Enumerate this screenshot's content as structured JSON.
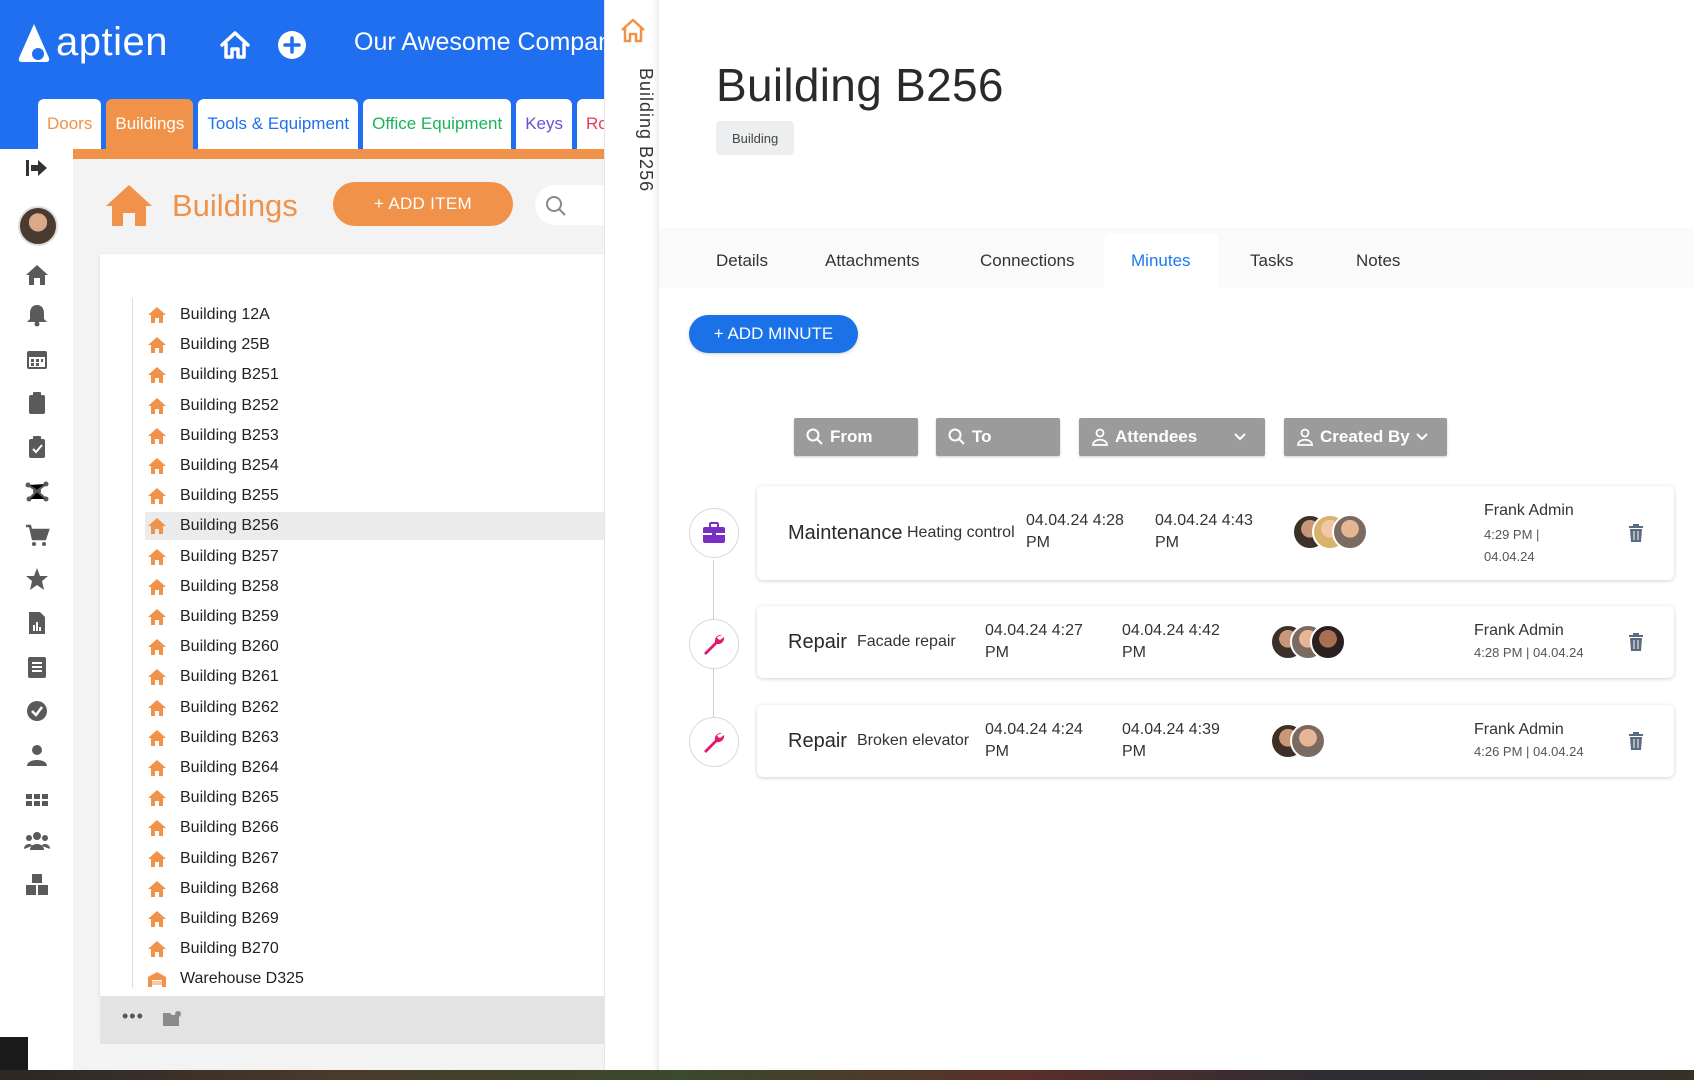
{
  "app": {
    "logo_text": "aptien",
    "company": "Our Awesome Company"
  },
  "tabs": [
    {
      "label": "Doors",
      "color": "#f0924a"
    },
    {
      "label": "Buildings",
      "color": "#ffffff"
    },
    {
      "label": "Tools & Equipment",
      "color": "#1f6ff0"
    },
    {
      "label": "Office Equipment",
      "color": "#19b35a"
    },
    {
      "label": "Keys",
      "color": "#6b4fd6"
    },
    {
      "label": "Ro",
      "color": "#e8375a"
    }
  ],
  "rail_icons": [
    "collapse-arrow-icon",
    "home-icon",
    "bell-icon",
    "calendar-icon",
    "clipboard-icon",
    "clipboard-check-icon",
    "network-icon",
    "cart-icon",
    "star-icon",
    "report-icon",
    "checklist-icon",
    "check-circle-icon",
    "person-icon",
    "apps-icon",
    "people-icon",
    "boxes-icon"
  ],
  "left": {
    "section_title": "Buildings",
    "add_item_label": "+ ADD ITEM",
    "tree_items": [
      "Building 12A",
      "Building 25B",
      "Building B251",
      "Building B252",
      "Building B253",
      "Building B254",
      "Building B255",
      "Building B256",
      "Building B257",
      "Building B258",
      "Building B259",
      "Building B260",
      "Building B261",
      "Building B262",
      "Building B263",
      "Building B264",
      "Building B265",
      "Building B266",
      "Building B267",
      "Building B268",
      "Building B269",
      "Building B270",
      "Warehouse D325"
    ],
    "selected_item": "Building B256",
    "footer_dots": "•••"
  },
  "panel": {
    "vertical_label": "Building B256",
    "title": "Building B256",
    "badge": "Building",
    "tabs": [
      "Details",
      "Attachments",
      "Connections",
      "Minutes",
      "Tasks",
      "Notes"
    ],
    "active_tab": "Minutes",
    "add_minute_label": "+ ADD MINUTE",
    "filters": {
      "from": "From",
      "to": "To",
      "attendees": "Attendees",
      "created_by": "Created By"
    },
    "minutes": [
      {
        "type": "Maintenance",
        "subject": "Heating control",
        "start_line1": "04.04.24 4:28",
        "start_line2": "PM",
        "end_line1": "04.04.24 4:43",
        "end_line2": "PM",
        "creator": "Frank Admin",
        "created_line1": "4:29 PM |",
        "created_line2": "04.04.24",
        "icon": "toolbox-icon",
        "attendee_count": 3
      },
      {
        "type": "Repair",
        "subject": "Facade repair",
        "start_line1": "04.04.24 4:27",
        "start_line2": "PM",
        "end_line1": "04.04.24 4:42",
        "end_line2": "PM",
        "creator": "Frank Admin",
        "created_line1": "4:28 PM | 04.04.24",
        "created_line2": "",
        "icon": "wrench-icon",
        "attendee_count": 3
      },
      {
        "type": "Repair",
        "subject": "Broken elevator",
        "start_line1": "04.04.24 4:24",
        "start_line2": "PM",
        "end_line1": "04.04.24 4:39",
        "end_line2": "PM",
        "creator": "Frank Admin",
        "created_line1": "4:26 PM | 04.04.24",
        "created_line2": "",
        "icon": "wrench-icon",
        "attendee_count": 2
      }
    ]
  },
  "colors": {
    "brand_blue": "#1f6ff0",
    "accent_orange": "#f0924a",
    "minute_blue": "#1b72e8",
    "tab_active_text": "#1b7be8",
    "icon_purple": "#7a2fc4",
    "icon_pink": "#e4196b"
  }
}
